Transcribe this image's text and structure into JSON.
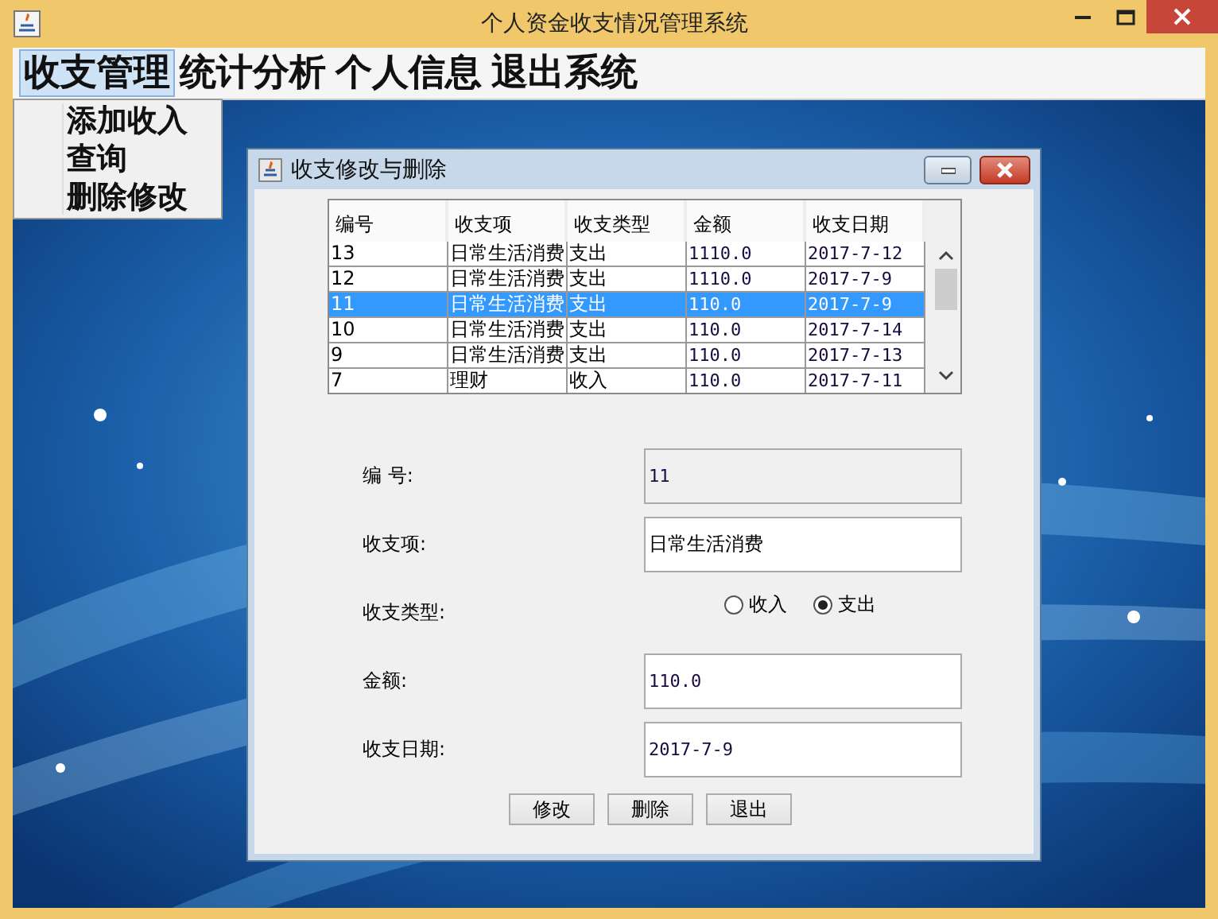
{
  "window": {
    "title": "个人资金收支情况管理系统"
  },
  "menu": [
    {
      "label": "收支管理",
      "selected": true
    },
    {
      "label": "统计分析",
      "selected": false
    },
    {
      "label": "个人信息",
      "selected": false
    },
    {
      "label": "退出系统",
      "selected": false
    }
  ],
  "open_menu": {
    "items": [
      "添加收入",
      "查询",
      "删除修改"
    ]
  },
  "dialog": {
    "title": "收支修改与删除",
    "table": {
      "columns": [
        "编号",
        "收支项",
        "收支类型",
        "金额",
        "收支日期"
      ],
      "rows": [
        {
          "cells": [
            "13",
            "日常生活消费",
            "支出",
            "1110.0",
            "2017-7-12"
          ],
          "selected": false
        },
        {
          "cells": [
            "12",
            "日常生活消费",
            "支出",
            "1110.0",
            "2017-7-9"
          ],
          "selected": false
        },
        {
          "cells": [
            "11",
            "日常生活消费",
            "支出",
            "110.0",
            "2017-7-9"
          ],
          "selected": true
        },
        {
          "cells": [
            "10",
            "日常生活消费",
            "支出",
            "110.0",
            "2017-7-14"
          ],
          "selected": false
        },
        {
          "cells": [
            "9",
            "日常生活消费",
            "支出",
            "110.0",
            "2017-7-13"
          ],
          "selected": false
        },
        {
          "cells": [
            "7",
            "理财",
            "收入",
            "110.0",
            "2017-7-11"
          ],
          "selected": false
        }
      ]
    },
    "fields": [
      {
        "kind": "text",
        "label": "编 号:",
        "value": "11",
        "disabled": true
      },
      {
        "kind": "text",
        "label": "收支项:",
        "value": "日常生活消费",
        "disabled": false
      },
      {
        "kind": "radio",
        "label": "收支类型:",
        "options": [
          {
            "label": "收入",
            "selected": false
          },
          {
            "label": "支出",
            "selected": true
          }
        ]
      },
      {
        "kind": "text",
        "label": "金额:",
        "value": "110.0",
        "disabled": false
      },
      {
        "kind": "text",
        "label": "收支日期:",
        "value": "2017-7-9",
        "disabled": false
      }
    ],
    "buttons": [
      "修改",
      "删除",
      "退出"
    ]
  }
}
